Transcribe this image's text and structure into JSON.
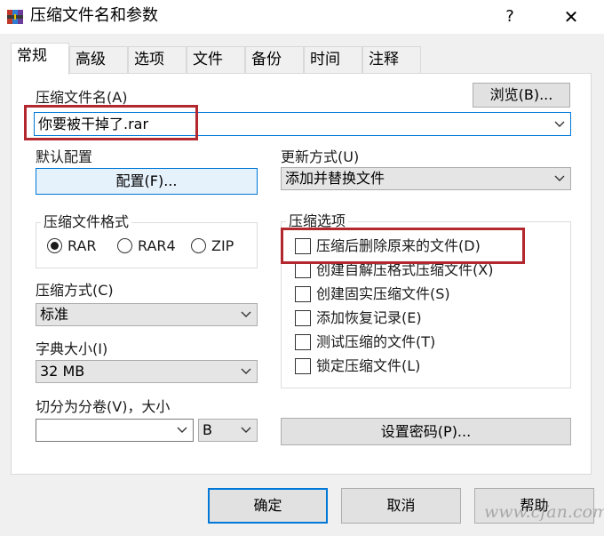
{
  "window": {
    "title": "压缩文件名和参数",
    "help_glyph": "?",
    "close_glyph": "✕"
  },
  "tabs": [
    {
      "label": "常规",
      "active": true
    },
    {
      "label": "高级"
    },
    {
      "label": "选项"
    },
    {
      "label": "文件"
    },
    {
      "label": "备份"
    },
    {
      "label": "时间"
    },
    {
      "label": "注释"
    }
  ],
  "archive": {
    "label": "压缩文件名(A)",
    "value": "你要被干掉了.rar",
    "browse_label": "浏览(B)..."
  },
  "profile": {
    "label": "默认配置",
    "button_label": "配置(F)..."
  },
  "update": {
    "label": "更新方式(U)",
    "value": "添加并替换文件"
  },
  "format": {
    "label": "压缩文件格式",
    "options": [
      {
        "label": "RAR",
        "selected": true
      },
      {
        "label": "RAR4",
        "selected": false
      },
      {
        "label": "ZIP",
        "selected": false
      }
    ]
  },
  "method": {
    "label": "压缩方式(C)",
    "value": "标准"
  },
  "dictionary": {
    "label": "字典大小(I)",
    "value": "32 MB"
  },
  "split": {
    "label": "切分为分卷(V)，大小",
    "value": "",
    "unit": "B"
  },
  "options": {
    "label": "压缩选项",
    "items": [
      {
        "label": "压缩后删除原来的文件(D)",
        "checked": false
      },
      {
        "label": "创建自解压格式压缩文件(X)",
        "checked": false
      },
      {
        "label": "创建固实压缩文件(S)",
        "checked": false
      },
      {
        "label": "添加恢复记录(E)",
        "checked": false
      },
      {
        "label": "测试压缩的文件(T)",
        "checked": false
      },
      {
        "label": "锁定压缩文件(L)",
        "checked": false
      }
    ]
  },
  "password_button": "设置密码(P)...",
  "footer": {
    "ok": "确定",
    "cancel": "取消",
    "help": "帮助"
  },
  "watermark": "www.cfan.com.cn",
  "colors": {
    "accent": "#0078d7",
    "highlight_box": "#b3272e"
  }
}
